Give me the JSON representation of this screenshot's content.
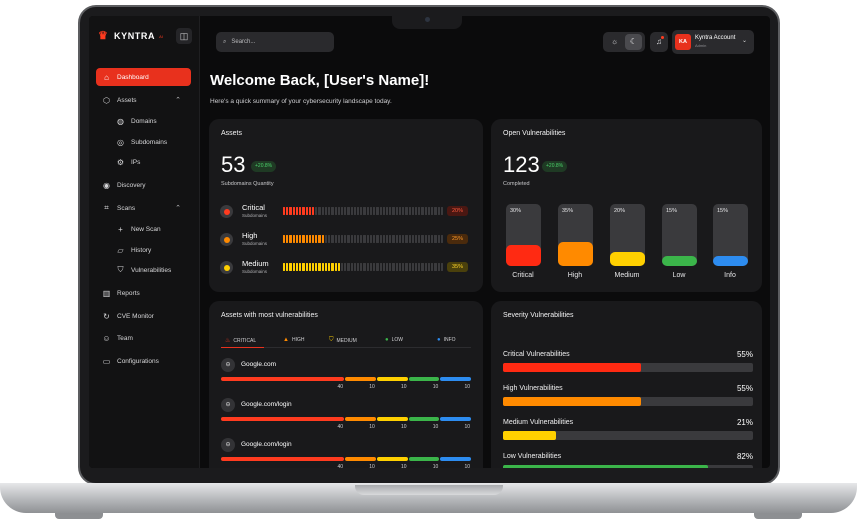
{
  "app": {
    "logo_text": "KYNTRA",
    "logo_sub": "AI"
  },
  "sidebar": {
    "items": [
      {
        "label": "Dashboard",
        "icon": "home-icon",
        "active": true
      },
      {
        "label": "Assets",
        "icon": "cube-icon",
        "expanded": true
      },
      {
        "label": "Domains",
        "icon": "globe-icon",
        "sub": true
      },
      {
        "label": "Subdomains",
        "icon": "target-icon",
        "sub": true
      },
      {
        "label": "IPs",
        "icon": "network-icon",
        "sub": true
      },
      {
        "label": "Discovery",
        "icon": "compass-icon"
      },
      {
        "label": "Scans",
        "icon": "scan-icon",
        "expanded": true
      },
      {
        "label": "New Scan",
        "icon": "plus-icon",
        "sub": true
      },
      {
        "label": "History",
        "icon": "folder-icon",
        "sub": true
      },
      {
        "label": "Vulnerabilities",
        "icon": "shield-icon",
        "sub": true
      },
      {
        "label": "Reports",
        "icon": "chart-icon"
      },
      {
        "label": "CVE Monitor",
        "icon": "refresh-icon"
      },
      {
        "label": "Team",
        "icon": "users-icon"
      },
      {
        "label": "Configurations",
        "icon": "folder-gear-icon"
      }
    ]
  },
  "topbar": {
    "search_placeholder": "Search...",
    "account_name": "Kyntra Account",
    "account_role": "Admin",
    "avatar_initials": "KA"
  },
  "welcome": {
    "title": "Welcome Back, [User's Name]!",
    "subtitle": "Here's a quick summary of your cybersecurity landscape today."
  },
  "assets_card": {
    "title": "Assets",
    "count": "53",
    "change": "+20.8%",
    "caption": "Subdomains Quantity",
    "rows": [
      {
        "name": "Critical",
        "sub": "Subdomains",
        "pct_label": "20%",
        "pct": 20,
        "color": "#ff3b1f",
        "pill_bg": "#4a1712",
        "pill_fg": "#ff5a3e"
      },
      {
        "name": "High",
        "sub": "Subdomains",
        "pct_label": "25%",
        "pct": 25,
        "color": "#ff8a00",
        "pill_bg": "#4a2a0c",
        "pill_fg": "#ff9a2a"
      },
      {
        "name": "Medium",
        "sub": "Subdomains",
        "pct_label": "35%",
        "pct": 35,
        "color": "#ffd000",
        "pill_bg": "#4a400c",
        "pill_fg": "#ffd52a"
      }
    ]
  },
  "open_vuln_card": {
    "title": "Open Vulnerabilities",
    "count": "123",
    "change": "+20.8%",
    "caption": "Completed",
    "bars": [
      {
        "label": "Critical",
        "pct_label": "30%",
        "value": 30,
        "color": "#ff2a12"
      },
      {
        "label": "High",
        "pct_label": "35%",
        "value": 35,
        "color": "#ff8a00"
      },
      {
        "label": "Medium",
        "pct_label": "20%",
        "value": 20,
        "color": "#ffd000"
      },
      {
        "label": "Low",
        "pct_label": "15%",
        "value": 15,
        "color": "#3bb54a"
      },
      {
        "label": "Info",
        "pct_label": "15%",
        "value": 15,
        "color": "#2d8cf0"
      }
    ]
  },
  "assets_vuln_card": {
    "title": "Assets with most vulnerabilities",
    "legend": [
      {
        "label": "CRITICAL",
        "icon": "flame-icon",
        "color": "#ff3b1f"
      },
      {
        "label": "HIGH",
        "icon": "warning-icon",
        "color": "#ff8a00"
      },
      {
        "label": "MEDIUM",
        "icon": "shield-icon",
        "color": "#ffd000"
      },
      {
        "label": "LOW",
        "icon": "check-circle-icon",
        "color": "#3bb54a"
      },
      {
        "label": "INFO",
        "icon": "info-icon",
        "color": "#2d8cf0"
      }
    ],
    "assets": [
      {
        "name": "Google.com",
        "values": [
          "40",
          "10",
          "10",
          "10",
          "10"
        ]
      },
      {
        "name": "Google.com/login",
        "values": [
          "40",
          "10",
          "10",
          "10",
          "10"
        ]
      },
      {
        "name": "Google.com/login",
        "values": [
          "40",
          "10",
          "10",
          "10",
          "10"
        ]
      }
    ]
  },
  "severity_card": {
    "title": "Severity Vulnerabilities",
    "rows": [
      {
        "label": "Critical Vulnerabilities",
        "pct_label": "55%",
        "value": 55,
        "color": "#ff2a12"
      },
      {
        "label": "High Vulnerabilities",
        "pct_label": "55%",
        "value": 55,
        "color": "#ff8a00"
      },
      {
        "label": "Medium Vulnerabilities",
        "pct_label": "21%",
        "value": 21,
        "color": "#ffd000"
      },
      {
        "label": "Low Vulnerabilities",
        "pct_label": "82%",
        "value": 82,
        "color": "#3bb54a"
      }
    ]
  }
}
